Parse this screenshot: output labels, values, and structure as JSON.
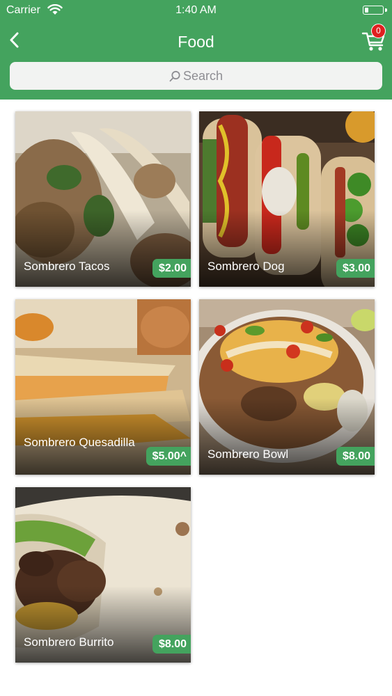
{
  "status_bar": {
    "carrier": "Carrier",
    "time": "1:40 AM"
  },
  "header": {
    "title": "Food",
    "cart_count": "0"
  },
  "search": {
    "placeholder": "Search"
  },
  "items": [
    {
      "name": "Sombrero Tacos",
      "price": "$2.00"
    },
    {
      "name": "Sombrero Dog",
      "price": "$3.00"
    },
    {
      "name": "Sombrero Quesadilla",
      "price": "$5.00^"
    },
    {
      "name": "Sombrero Bowl",
      "price": "$8.00"
    },
    {
      "name": "Sombrero Burrito",
      "price": "$8.00"
    }
  ],
  "colors": {
    "accent": "#44a35e",
    "badge": "#e02020"
  },
  "icons": [
    "wifi-icon",
    "battery-icon",
    "back-chevron-icon",
    "cart-icon",
    "search-icon"
  ]
}
